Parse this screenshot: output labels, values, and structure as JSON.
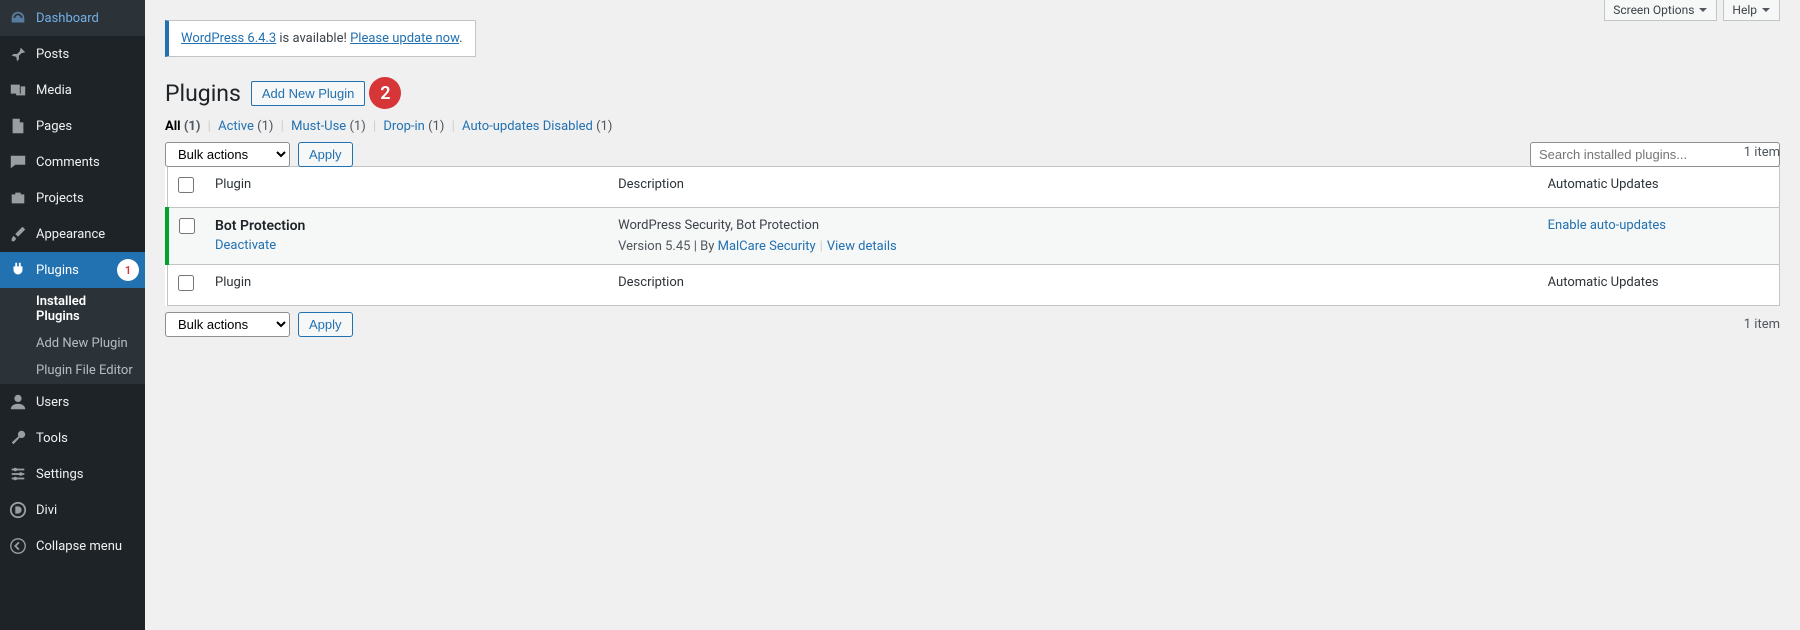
{
  "sidebar": {
    "items": [
      {
        "name": "dashboard",
        "label": "Dashboard"
      },
      {
        "name": "posts",
        "label": "Posts"
      },
      {
        "name": "media",
        "label": "Media"
      },
      {
        "name": "pages",
        "label": "Pages"
      },
      {
        "name": "comments",
        "label": "Comments"
      },
      {
        "name": "projects",
        "label": "Projects"
      },
      {
        "name": "appearance",
        "label": "Appearance"
      },
      {
        "name": "plugins",
        "label": "Plugins",
        "badge": "1"
      },
      {
        "name": "users",
        "label": "Users"
      },
      {
        "name": "tools",
        "label": "Tools"
      },
      {
        "name": "settings",
        "label": "Settings"
      },
      {
        "name": "divi",
        "label": "Divi"
      },
      {
        "name": "collapse",
        "label": "Collapse menu"
      }
    ],
    "submenu": [
      {
        "label": "Installed Plugins",
        "current": true
      },
      {
        "label": "Add New Plugin"
      },
      {
        "label": "Plugin File Editor"
      }
    ]
  },
  "top_tabs": {
    "screen_options": "Screen Options",
    "help": "Help"
  },
  "notice": {
    "link1": "WordPress 6.4.3",
    "mid": " is available! ",
    "link2": "Please update now",
    "end": "."
  },
  "heading": {
    "title": "Plugins",
    "add_new": "Add New Plugin",
    "badge": "2"
  },
  "filters": {
    "all": "All",
    "all_count": "(1)",
    "active": "Active",
    "active_count": "(1)",
    "mustuse": "Must-Use",
    "mustuse_count": "(1)",
    "dropin": "Drop-in",
    "dropin_count": "(1)",
    "auto": "Auto-updates Disabled",
    "auto_count": "(1)"
  },
  "bulk": {
    "label": "Bulk actions",
    "apply": "Apply"
  },
  "search": {
    "placeholder": "Search installed plugins..."
  },
  "pagination": {
    "text": "1 item"
  },
  "table": {
    "col_plugin": "Plugin",
    "col_desc": "Description",
    "col_auto": "Automatic Updates",
    "rows": [
      {
        "name": "Bot Protection",
        "action": "Deactivate",
        "desc": "WordPress Security, Bot Protection",
        "version_prefix": "Version ",
        "version": "5.45",
        "by": " | By ",
        "author": "MalCare Security",
        "view": "View details",
        "auto_action": "Enable auto-updates"
      }
    ]
  }
}
